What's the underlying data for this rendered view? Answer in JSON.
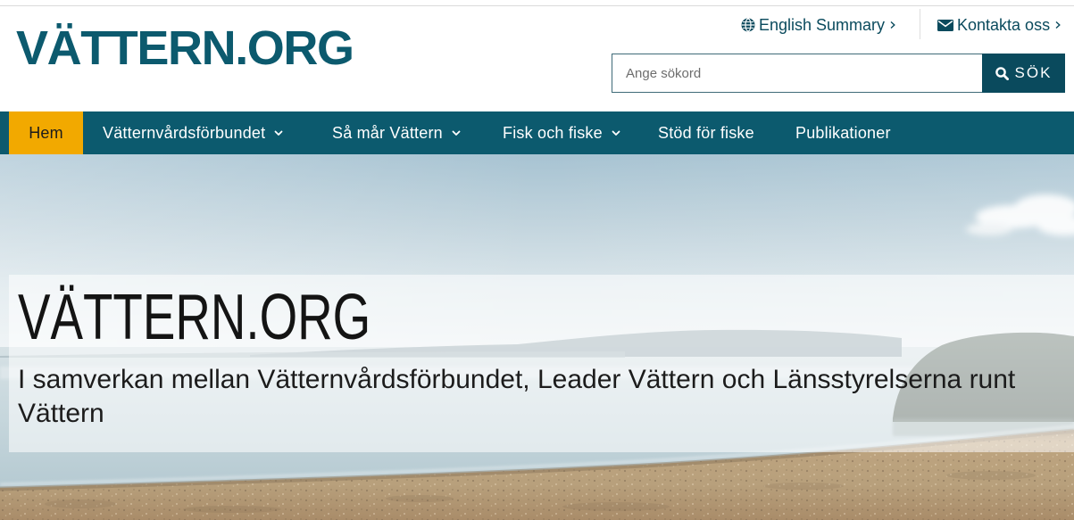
{
  "site": {
    "logo_text": "VÄTTERN.ORG"
  },
  "utility_nav": [
    {
      "label": "English Summary",
      "icon": "globe-icon",
      "trailing_icon": "chevron-right-icon"
    },
    {
      "label": "Kontakta oss",
      "icon": "envelope-icon",
      "trailing_icon": "chevron-right-icon"
    }
  ],
  "search": {
    "placeholder": "Ange sökord",
    "button_label": "SÖK",
    "button_icon": "search-icon"
  },
  "main_nav": {
    "items": [
      {
        "label": "Hem",
        "active": true,
        "dropdown": false
      },
      {
        "label": "Vätternvårdsförbundet",
        "active": false,
        "dropdown": true
      },
      {
        "label": "Så mår Vättern",
        "active": false,
        "dropdown": true
      },
      {
        "label": "Fisk och fiske",
        "active": false,
        "dropdown": true
      },
      {
        "label": "Stöd för fiske",
        "active": false,
        "dropdown": false
      },
      {
        "label": "Publikationer",
        "active": false,
        "dropdown": false
      }
    ]
  },
  "hero": {
    "title": "VÄTTERN.ORG",
    "subtitle": "I samverkan mellan Vätternvårdsförbundet, Leader Vättern och Länsstyrelserna runt Vättern"
  },
  "colors": {
    "brand": "#0c5a6e",
    "brand_dark": "#0a4a5d",
    "accent": "#f2a900"
  }
}
